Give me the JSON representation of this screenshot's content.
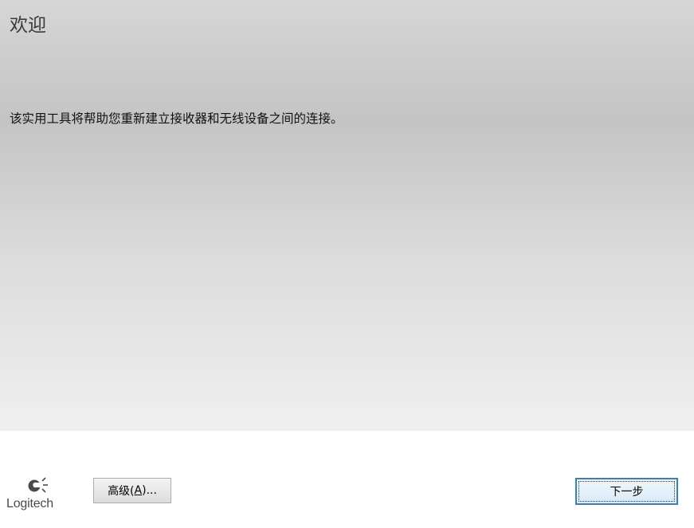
{
  "page": {
    "title": "欢迎",
    "description": "该实用工具将帮助您重新建立接收器和无线设备之间的连接。"
  },
  "footer": {
    "logo_text": "Logitech",
    "advanced_button": {
      "prefix": "高级(",
      "accelerator": "A",
      "suffix": ")..."
    },
    "next_button_label": "下一步"
  },
  "colors": {
    "next_button_border": "#3c7fb1",
    "title_text": "#3a3a3a"
  }
}
